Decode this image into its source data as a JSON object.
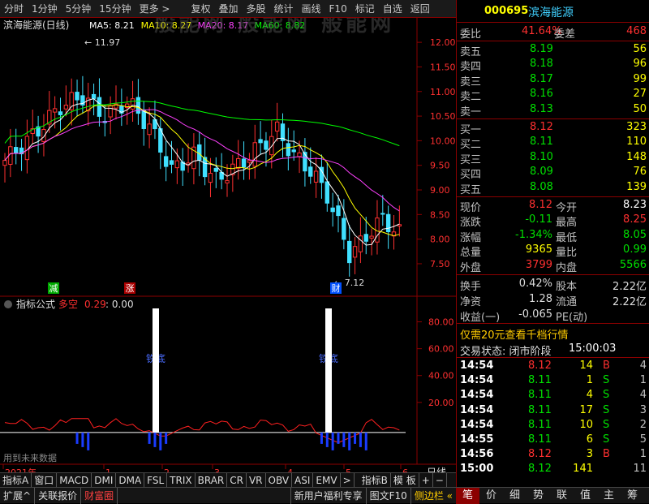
{
  "toolbar": {
    "items": [
      "分时",
      "1分钟",
      "5分钟",
      "15分钟",
      "更多 >",
      "复权",
      "叠加",
      "多股",
      "统计",
      "画线",
      "F10",
      "标记",
      "自选",
      "返回"
    ]
  },
  "watermark": "般能网 般能网 般能网",
  "stock": {
    "code": "000695",
    "name": "滨海能源",
    "chart_label": "滨海能源(日线)"
  },
  "ma_legend": [
    {
      "label": "MA5: 8.21",
      "color": "#ffffff"
    },
    {
      "label": "MA10: 8.27",
      "color": "#ffff00"
    },
    {
      "label": "MA20: 8.17",
      "color": "#ff40ff"
    },
    {
      "label": "MA60: 8.82",
      "color": "#00ff00"
    }
  ],
  "chart_data": [
    {
      "type": "candlestick",
      "name": "滨海能源(日线)",
      "y_ticks": [
        12.0,
        11.5,
        11.0,
        10.5,
        10.0,
        9.5,
        9.0,
        8.5,
        8.0,
        7.5
      ],
      "ylim": [
        7.12,
        12.2
      ],
      "annotations": [
        {
          "text": "11.97",
          "value": 11.97
        },
        {
          "text": "7.12",
          "value": 7.12
        }
      ],
      "markers": [
        {
          "text": "减",
          "color": "#00aa00"
        },
        {
          "text": "涨",
          "color": "#aa0000"
        },
        {
          "text": "财",
          "color": "#0050ff"
        }
      ],
      "x_axis_labels": [
        "2021年",
        "1",
        "2",
        "3",
        "4",
        "5",
        "6"
      ],
      "last_close": 8.12
    },
    {
      "type": "line",
      "name": "指标公式",
      "series": [
        {
          "name": "多空",
          "value_text": "0.29",
          "color": "#ff3030"
        }
      ],
      "extra": ": 0.00",
      "y_ticks": [
        80.0,
        60.0,
        40.0,
        20.0
      ],
      "ylim": [
        -20,
        90
      ],
      "signals": [
        {
          "text": "铁底",
          "arrow": "↑",
          "bar_height": 90
        },
        {
          "text": "铁底",
          "arrow": "↑",
          "bar_height": 90
        }
      ],
      "note": "用到未来数据"
    }
  ],
  "x_axis_right": "日线",
  "bottom_tabs": [
    "指标A",
    "窗口",
    "MACD",
    "DMI",
    "DMA",
    "FSL",
    "TRIX",
    "BRAR",
    "CR",
    "VR",
    "OBV",
    "ASI",
    "EMV",
    ">",
    "指标B",
    "模 板",
    "+",
    "−"
  ],
  "bottom_bar": {
    "left": [
      "扩展^",
      "关联报价",
      "财富圈"
    ],
    "right": [
      "新用户福利专享",
      "图文F10",
      "侧边栏 «"
    ],
    "right_tabs": [
      "笔",
      "价",
      "细",
      "势",
      "联",
      "值",
      "主",
      "筹"
    ]
  },
  "quote": {
    "weibi_label": "委比",
    "weibi": "41.64%",
    "weicha_label": "委差",
    "weicha": "468",
    "asks": [
      {
        "label": "卖五",
        "price": "8.19",
        "vol": "56"
      },
      {
        "label": "卖四",
        "price": "8.18",
        "vol": "96"
      },
      {
        "label": "卖三",
        "price": "8.17",
        "vol": "99"
      },
      {
        "label": "卖二",
        "price": "8.16",
        "vol": "27"
      },
      {
        "label": "卖一",
        "price": "8.13",
        "vol": "50"
      }
    ],
    "bids": [
      {
        "label": "买一",
        "price": "8.12",
        "vol": "323"
      },
      {
        "label": "买二",
        "price": "8.11",
        "vol": "110"
      },
      {
        "label": "买三",
        "price": "8.10",
        "vol": "148"
      },
      {
        "label": "买四",
        "price": "8.09",
        "vol": "76"
      },
      {
        "label": "买五",
        "price": "8.08",
        "vol": "139"
      }
    ],
    "stats": [
      {
        "l1": "现价",
        "v1": "8.12",
        "c1": "#ff3030",
        "l2": "今开",
        "v2": "8.23",
        "c2": "#ffffff"
      },
      {
        "l1": "涨跌",
        "v1": "-0.11",
        "c1": "#00e000",
        "l2": "最高",
        "v2": "8.25",
        "c2": "#ff3030"
      },
      {
        "l1": "涨幅",
        "v1": "-1.34%",
        "c1": "#00e000",
        "l2": "最低",
        "v2": "8.05",
        "c2": "#00e000"
      },
      {
        "l1": "总量",
        "v1": "9365",
        "c1": "#ffff00",
        "l2": "量比",
        "v2": "0.99",
        "c2": "#00e000"
      },
      {
        "l1": "外盘",
        "v1": "3799",
        "c1": "#ff3030",
        "l2": "内盘",
        "v2": "5566",
        "c2": "#00e000"
      }
    ],
    "stats2": [
      {
        "l1": "换手",
        "v1": "0.42%",
        "l2": "股本",
        "v2": "2.22亿"
      },
      {
        "l1": "净资",
        "v1": "1.28",
        "l2": "流通",
        "v2": "2.22亿"
      },
      {
        "l1": "收益(一)",
        "v1": "-0.065",
        "l2": "PE(动)",
        "v2": ""
      }
    ],
    "promo": "仅需20元查看千档行情",
    "status_label": "交易状态: 闭市阶段",
    "status_time": "15:00:03",
    "ticks": [
      {
        "time": "14:54",
        "price": "8.12",
        "vol": "14",
        "bs": "B",
        "n": "4"
      },
      {
        "time": "14:54",
        "price": "8.11",
        "vol": "1",
        "bs": "S",
        "n": "1"
      },
      {
        "time": "14:54",
        "price": "8.11",
        "vol": "4",
        "bs": "S",
        "n": "4"
      },
      {
        "time": "14:54",
        "price": "8.11",
        "vol": "17",
        "bs": "S",
        "n": "3"
      },
      {
        "time": "14:54",
        "price": "8.11",
        "vol": "10",
        "bs": "S",
        "n": "2"
      },
      {
        "time": "14:55",
        "price": "8.11",
        "vol": "6",
        "bs": "S",
        "n": "5"
      },
      {
        "time": "14:56",
        "price": "8.12",
        "vol": "3",
        "bs": "B",
        "n": "1"
      },
      {
        "time": "15:00",
        "price": "8.12",
        "vol": "141",
        "bs": "",
        "n": "11"
      }
    ]
  }
}
